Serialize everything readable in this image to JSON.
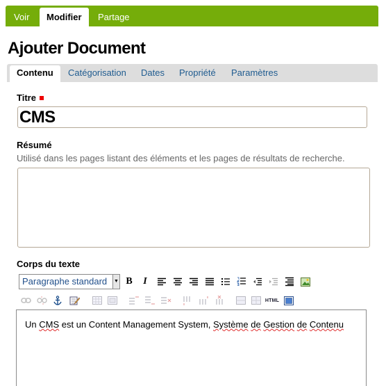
{
  "top_tabs": [
    {
      "label": "Voir"
    },
    {
      "label": "Modifier",
      "active": true
    },
    {
      "label": "Partage"
    }
  ],
  "colors": {
    "top_bar": "#75ad0a",
    "required_marker": "#e00000",
    "link": "#205c90"
  },
  "page_title": "Ajouter Document",
  "sub_tabs": [
    {
      "label": "Contenu",
      "active": true
    },
    {
      "label": "Catégorisation"
    },
    {
      "label": "Dates"
    },
    {
      "label": "Propriété"
    },
    {
      "label": "Paramètres"
    }
  ],
  "form": {
    "title_label": "Titre",
    "title_value": "CMS",
    "summary_label": "Résumé",
    "summary_help": "Utilisé dans les pages listant des éléments et les pages de résultats de recherche.",
    "summary_value": "",
    "body_label": "Corps du texte"
  },
  "editor": {
    "format_select": "Paragraphe standard",
    "html_button": "HTML",
    "toolbar_icons": [
      "bold-icon",
      "italic-icon",
      "align-left-icon",
      "align-center-icon",
      "align-right-icon",
      "align-justify-icon",
      "bullet-list-icon",
      "numbered-list-icon",
      "outdent-icon",
      "indent-icon",
      "definition-list-icon",
      "insert-image-icon",
      "link-icon",
      "unlink-icon",
      "anchor-icon",
      "edit-icon",
      "table-icon",
      "table-props-icon",
      "row-insert-before-icon",
      "row-insert-after-icon",
      "row-delete-icon",
      "col-insert-before-icon",
      "col-insert-after-icon",
      "col-delete-icon",
      "merge-cells-icon",
      "split-cells-icon",
      "html-source-icon",
      "fullscreen-icon"
    ],
    "content_words": [
      "Un",
      "CMS",
      "est un Content Management System,",
      "Système",
      "de",
      "Gestion",
      "de",
      "Contenu"
    ]
  }
}
